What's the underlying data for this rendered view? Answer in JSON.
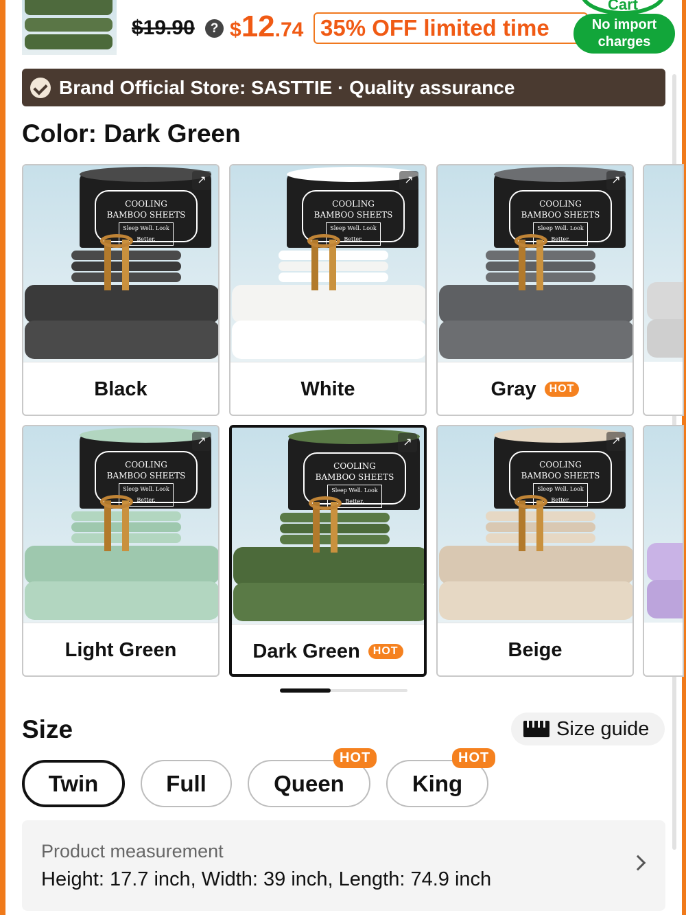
{
  "price_bar": {
    "old_price": "$19.90",
    "new_price_currency": "$",
    "new_price_int": "12",
    "new_price_dec": ".74",
    "discount": "35% OFF limited time",
    "cart_label": "Cart",
    "import_badge_line1": "No import",
    "import_badge_line2": "charges"
  },
  "brand_banner": {
    "text": "Brand Official Store: SASTTIE · Quality assurance"
  },
  "color": {
    "heading": "Color:",
    "selected": "Dark Green",
    "options": [
      {
        "label": "Black",
        "hot": "",
        "swatch": "#3a3a3a",
        "swatch_light": "#4a4a4a"
      },
      {
        "label": "White",
        "hot": "",
        "swatch": "#f4f4f2",
        "swatch_light": "#ffffff"
      },
      {
        "label": "Gray",
        "hot": "HOT",
        "swatch": "#5e6063",
        "swatch_light": "#6c6e71"
      },
      {
        "label": "Light Green",
        "hot": "",
        "swatch": "#9ec8ae",
        "swatch_light": "#b2d6c0"
      },
      {
        "label": "Dark Green",
        "hot": "HOT",
        "swatch": "#4c6a3a",
        "swatch_light": "#5a7a46"
      },
      {
        "label": "Beige",
        "hot": "",
        "swatch": "#d9c8b2",
        "swatch_light": "#e6d8c4"
      }
    ],
    "package_text_line1": "COOLING",
    "package_text_line2": "BAMBOO SHEETS",
    "package_tagline": "Sleep Well. Look Better."
  },
  "size": {
    "heading": "Size",
    "guide_label": "Size guide",
    "options": [
      {
        "label": "Twin",
        "hot": ""
      },
      {
        "label": "Full",
        "hot": ""
      },
      {
        "label": "Queen",
        "hot": "HOT"
      },
      {
        "label": "King",
        "hot": "HOT"
      }
    ],
    "selected": "Twin"
  },
  "measurement": {
    "title": "Product measurement",
    "value": "Height: 17.7 inch, Width: 39 inch, Length: 74.9 inch"
  }
}
